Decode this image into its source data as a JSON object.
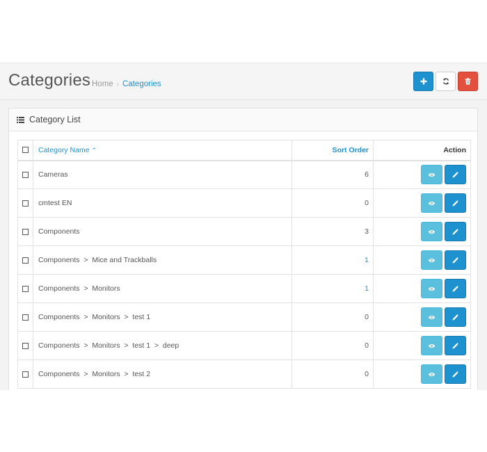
{
  "header": {
    "title": "Categories",
    "breadcrumb": [
      {
        "label": "Home"
      },
      {
        "label": "Categories"
      }
    ],
    "buttons": {
      "add": "plus-icon",
      "refresh": "refresh-icon",
      "delete": "trash-icon"
    }
  },
  "panel": {
    "title": "Category List",
    "icon": "list-icon"
  },
  "table": {
    "columns": {
      "name": "Category Name",
      "sort_order": "Sort Order",
      "action": "Action"
    },
    "sort_indicator": "ascending",
    "rows": [
      {
        "name": "Cameras",
        "sort_order": "6",
        "highlight": false
      },
      {
        "name": "cmtest EN",
        "sort_order": "0",
        "highlight": false
      },
      {
        "name": "Components",
        "sort_order": "3",
        "highlight": false
      },
      {
        "name": "Components  >  Mice and Trackballs",
        "sort_order": "1",
        "highlight": true
      },
      {
        "name": "Components  >  Monitors",
        "sort_order": "1",
        "highlight": true
      },
      {
        "name": "Components  >  Monitors  >  test 1",
        "sort_order": "0",
        "highlight": false
      },
      {
        "name": "Components  >  Monitors  >  test 1  >  deep",
        "sort_order": "0",
        "highlight": false
      },
      {
        "name": "Components  >  Monitors  >  test 2",
        "sort_order": "0",
        "highlight": false
      }
    ]
  },
  "colors": {
    "primary": "#1e91cf",
    "info": "#5bc0de",
    "danger": "#e3503e"
  }
}
